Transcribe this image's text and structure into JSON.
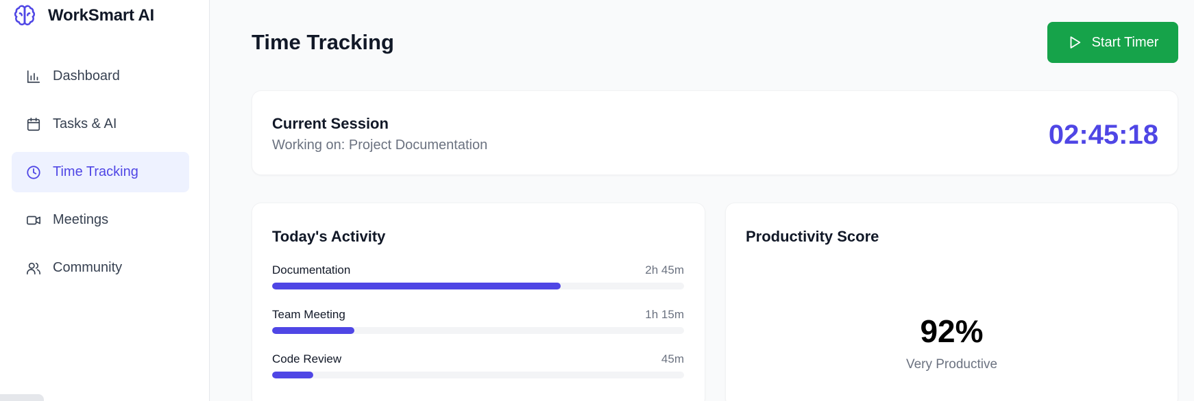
{
  "app": {
    "name": "WorkSmart AI",
    "logo_icon": "brain-icon"
  },
  "sidebar": {
    "items": [
      {
        "label": "Dashboard",
        "icon": "bar-chart-icon",
        "active": false
      },
      {
        "label": "Tasks & AI",
        "icon": "calendar-icon",
        "active": false
      },
      {
        "label": "Time Tracking",
        "icon": "clock-icon",
        "active": true
      },
      {
        "label": "Meetings",
        "icon": "video-icon",
        "active": false
      },
      {
        "label": "Community",
        "icon": "users-icon",
        "active": false
      }
    ]
  },
  "header": {
    "title": "Time Tracking",
    "start_button": "Start Timer"
  },
  "session": {
    "title": "Current Session",
    "subtitle": "Working on: Project Documentation",
    "timer": "02:45:18"
  },
  "activity": {
    "title": "Today's Activity",
    "items": [
      {
        "name": "Documentation",
        "time": "2h 45m",
        "progress": 0.7
      },
      {
        "name": "Team Meeting",
        "time": "1h 15m",
        "progress": 0.2
      },
      {
        "name": "Code Review",
        "time": "45m",
        "progress": 0.1
      }
    ]
  },
  "productivity": {
    "title": "Productivity Score",
    "value": "92%",
    "label": "Very Productive"
  },
  "colors": {
    "accent": "#4f46e5",
    "active_bg": "#eef2ff",
    "start_button": "#16a34a",
    "text_muted": "#6b7280"
  }
}
